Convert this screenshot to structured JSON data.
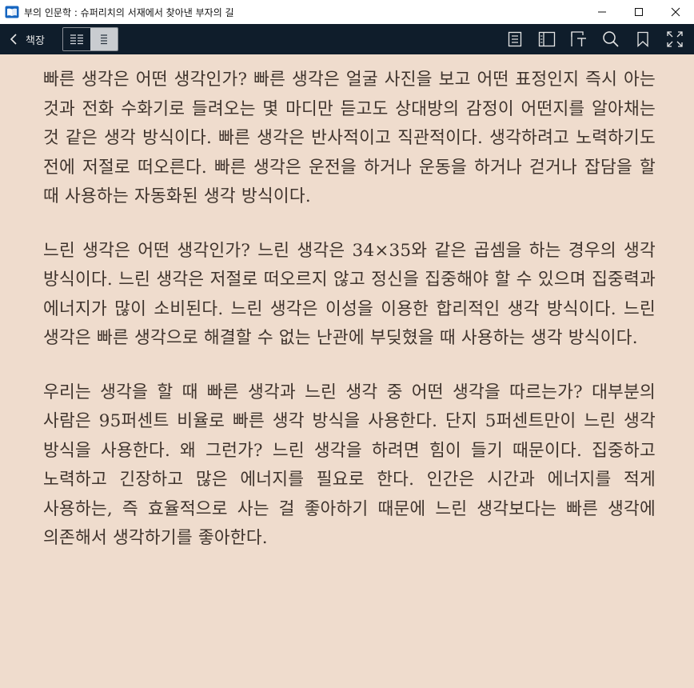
{
  "window": {
    "title": "부의 인문학 : 슈퍼리치의 서재에서 찾아낸 부자의 길"
  },
  "toolbar": {
    "back_label": "책장"
  },
  "colors": {
    "page_background": "#efdccd",
    "toolbar_background": "#0f1d2b",
    "text": "#3f342d"
  },
  "content": {
    "paragraphs": [
      "빠른 생각은 어떤 생각인가? 빠른 생각은 얼굴 사진을 보고 어떤 표정인지 즉시 아는 것과 전화 수화기로 들려오는 몇 마디만 듣고도 상대방의 감정이 어떤지를 알아채는 것 같은 생각 방식이다. 빠른 생각은 반사적이고 직관적이다. 생각하려고 노력하기도 전에 저절로 떠오른다. 빠른 생각은 운전을 하거나 운동을 하거나 걷거나 잡담을 할 때 사용하는 자동화된 생각 방식이다.",
      "느린 생각은 어떤 생각인가? 느린 생각은 34×35와 같은 곱셈을 하는 경우의 생각 방식이다. 느린 생각은 저절로 떠오르지 않고 정신을 집중해야 할 수 있으며 집중력과 에너지가 많이 소비된다. 느린 생각은 이성을 이용한 합리적인 생각 방식이다. 느린 생각은 빠른 생각으로 해결할 수 없는 난관에 부딪혔을 때 사용하는 생각 방식이다.",
      "우리는 생각을 할 때 빠른 생각과 느린 생각 중 어떤 생각을 따르는가? 대부분의 사람은 95퍼센트 비율로 빠른 생각 방식을 사용한다. 단지 5퍼센트만이 느린 생각 방식을 사용한다. 왜 그런가? 느린 생각을 하려면 힘이 들기 때문이다. 집중하고 노력하고 긴장하고 많은 에너지를 필요로 한다. 인간은 시간과 에너지를 적게 사용하는, 즉 효율적으로 사는 걸 좋아하기 때문에 느린 생각보다는 빠른 생각에 의존해서 생각하기를 좋아한다."
    ]
  }
}
